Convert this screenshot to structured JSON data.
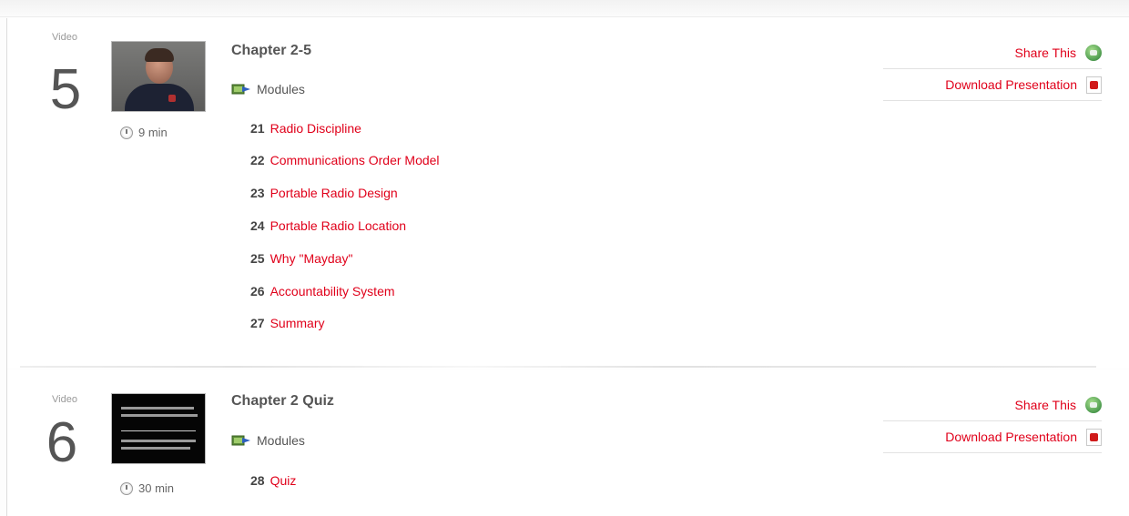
{
  "videos": [
    {
      "label": "Video",
      "number": "5",
      "duration": "9 min",
      "thumbnail": "presenter-video-thumbnail",
      "title": "Chapter 2-5",
      "modules_label": "Modules",
      "modules": [
        {
          "num": "21",
          "title": "Radio Discipline"
        },
        {
          "num": "22",
          "title": "Communications Order Model"
        },
        {
          "num": "23",
          "title": "Portable Radio Design"
        },
        {
          "num": "24",
          "title": "Portable Radio Location"
        },
        {
          "num": "25",
          "title": "Why \"Mayday\""
        },
        {
          "num": "26",
          "title": "Accountability System"
        },
        {
          "num": "27",
          "title": "Summary"
        }
      ],
      "actions": {
        "share": "Share This",
        "download": "Download Presentation"
      }
    },
    {
      "label": "Video",
      "number": "6",
      "duration": "30 min",
      "thumbnail": "quiz-instructions-thumbnail",
      "title": "Chapter 2 Quiz",
      "modules_label": "Modules",
      "modules": [
        {
          "num": "28",
          "title": "Quiz"
        }
      ],
      "actions": {
        "share": "Share This",
        "download": "Download Presentation"
      }
    }
  ],
  "icons": {
    "duration": "clock-icon",
    "modules": "modules-icon",
    "share": "share-icon",
    "download": "pdf-icon"
  },
  "colors": {
    "link": "#e0001a",
    "text": "#555555",
    "muted": "#999999",
    "share_icon": "#4c9a4e",
    "pdf_icon": "#d01a1a"
  }
}
